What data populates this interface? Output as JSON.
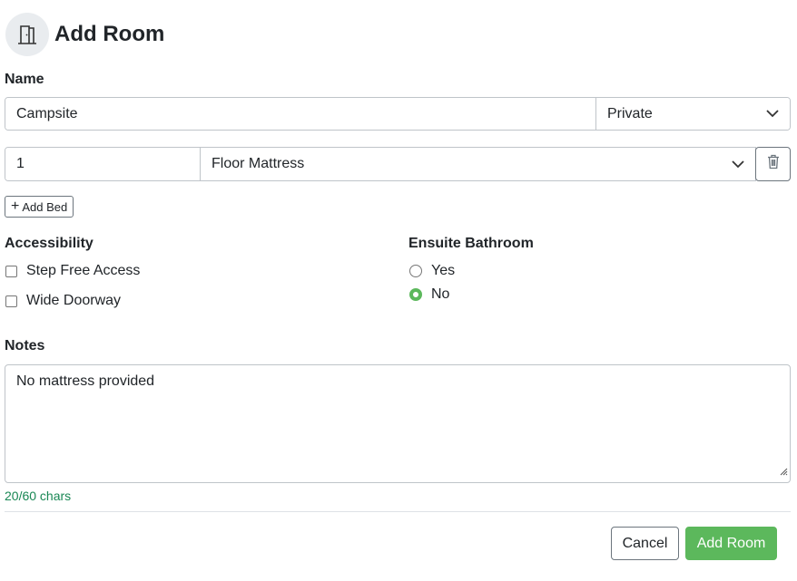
{
  "header": {
    "title": "Add Room",
    "icon": "door-icon"
  },
  "name_section": {
    "label": "Name",
    "name_value": "Campsite",
    "privacy_value": "Private"
  },
  "bed_row": {
    "quantity_value": "1",
    "bed_type_value": "Floor Mattress",
    "delete_icon": "trash-icon"
  },
  "add_bed_label": "Add Bed",
  "accessibility": {
    "label": "Accessibility",
    "options": [
      {
        "label": "Step Free Access",
        "checked": false
      },
      {
        "label": "Wide Doorway",
        "checked": false
      }
    ]
  },
  "ensuite": {
    "label": "Ensuite Bathroom",
    "options": [
      {
        "label": "Yes",
        "selected": false
      },
      {
        "label": "No",
        "selected": true
      }
    ]
  },
  "notes": {
    "label": "Notes",
    "value": "No mattress provided",
    "counter": "20/60 chars"
  },
  "footer": {
    "cancel_label": "Cancel",
    "submit_label": "Add Room"
  },
  "colors": {
    "accent": "#5cb85c",
    "counter": "#198754",
    "border": "#bfc4c9"
  }
}
